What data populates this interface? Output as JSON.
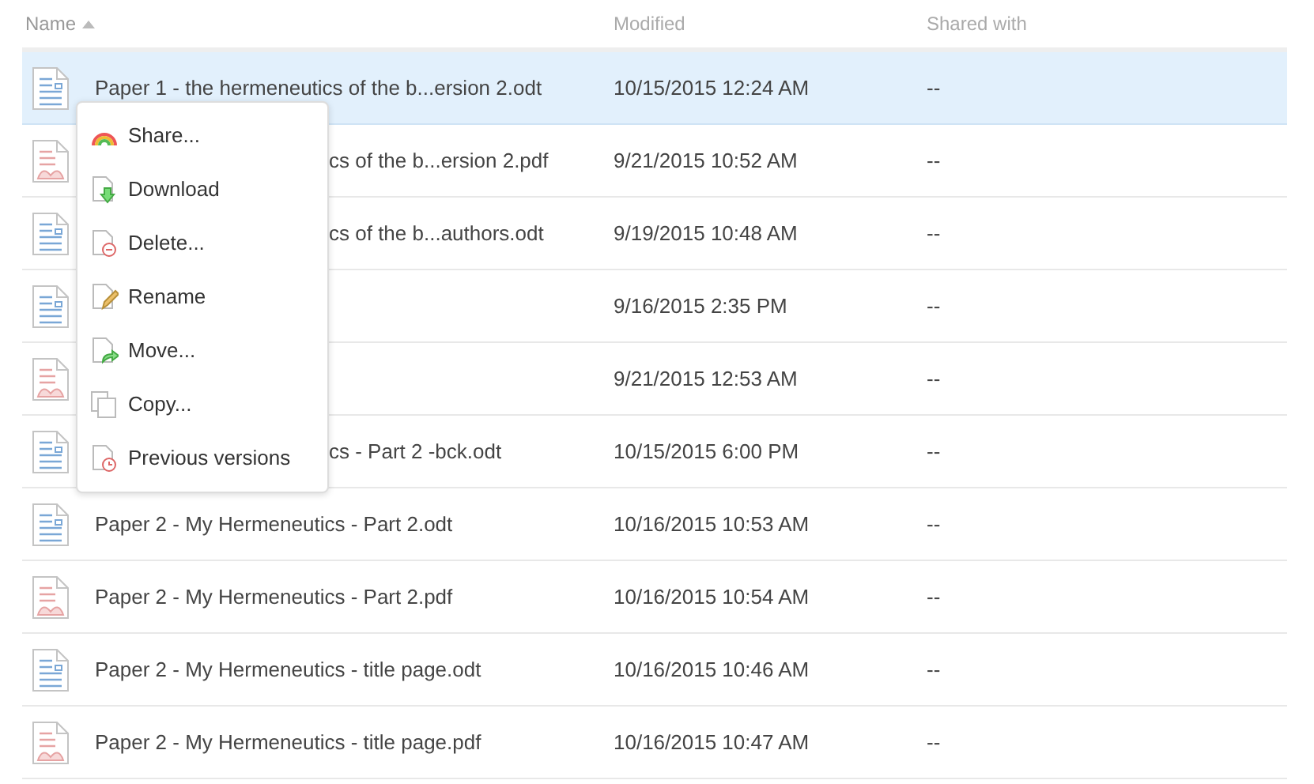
{
  "columns": [
    {
      "label": "Name",
      "sorted": true
    },
    {
      "label": "Modified",
      "sorted": false
    },
    {
      "label": "Shared with",
      "sorted": false
    }
  ],
  "rows": [
    {
      "kind": "odt",
      "selected": true,
      "name": "Paper 1 - the hermeneutics of the b...ersion 2.odt",
      "modified": "10/15/2015 12:24 AM",
      "shared": "--"
    },
    {
      "kind": "pdf",
      "selected": false,
      "covered": true,
      "name": "cs of the b...ersion 2.pdf",
      "modified": "9/21/2015 10:52 AM",
      "shared": "--"
    },
    {
      "kind": "odt",
      "selected": false,
      "covered": true,
      "name": "cs of the b...authors.odt",
      "modified": "9/19/2015 10:48 AM",
      "shared": "--"
    },
    {
      "kind": "odt",
      "selected": false,
      "modified": "9/16/2015 2:35 PM",
      "shared": "--"
    },
    {
      "kind": "pdf",
      "selected": false,
      "modified": "9/21/2015 12:53 AM",
      "shared": "--"
    },
    {
      "kind": "odt",
      "selected": false,
      "covered": true,
      "name": "cs - Part 2 -bck.odt",
      "modified": "10/15/2015 6:00 PM",
      "shared": "--"
    },
    {
      "kind": "odt",
      "selected": false,
      "name": "Paper 2 - My Hermeneutics - Part 2.odt",
      "modified": "10/16/2015 10:53 AM",
      "shared": "--"
    },
    {
      "kind": "pdf",
      "selected": false,
      "name": "Paper 2 - My Hermeneutics - Part 2.pdf",
      "modified": "10/16/2015 10:54 AM",
      "shared": "--"
    },
    {
      "kind": "odt",
      "selected": false,
      "name": "Paper 2 - My Hermeneutics - title page.odt",
      "modified": "10/16/2015 10:46 AM",
      "shared": "--"
    },
    {
      "kind": "pdf",
      "selected": false,
      "name": "Paper 2 - My Hermeneutics - title page.pdf",
      "modified": "10/16/2015 10:47 AM",
      "shared": "--"
    }
  ],
  "menu": [
    {
      "kind": "share",
      "label": "Share..."
    },
    {
      "kind": "download",
      "label": "Download"
    },
    {
      "kind": "delete",
      "label": "Delete..."
    },
    {
      "kind": "rename",
      "label": "Rename"
    },
    {
      "kind": "move",
      "label": "Move..."
    },
    {
      "kind": "copy",
      "label": "Copy..."
    },
    {
      "kind": "versions",
      "label": "Previous versions"
    }
  ]
}
